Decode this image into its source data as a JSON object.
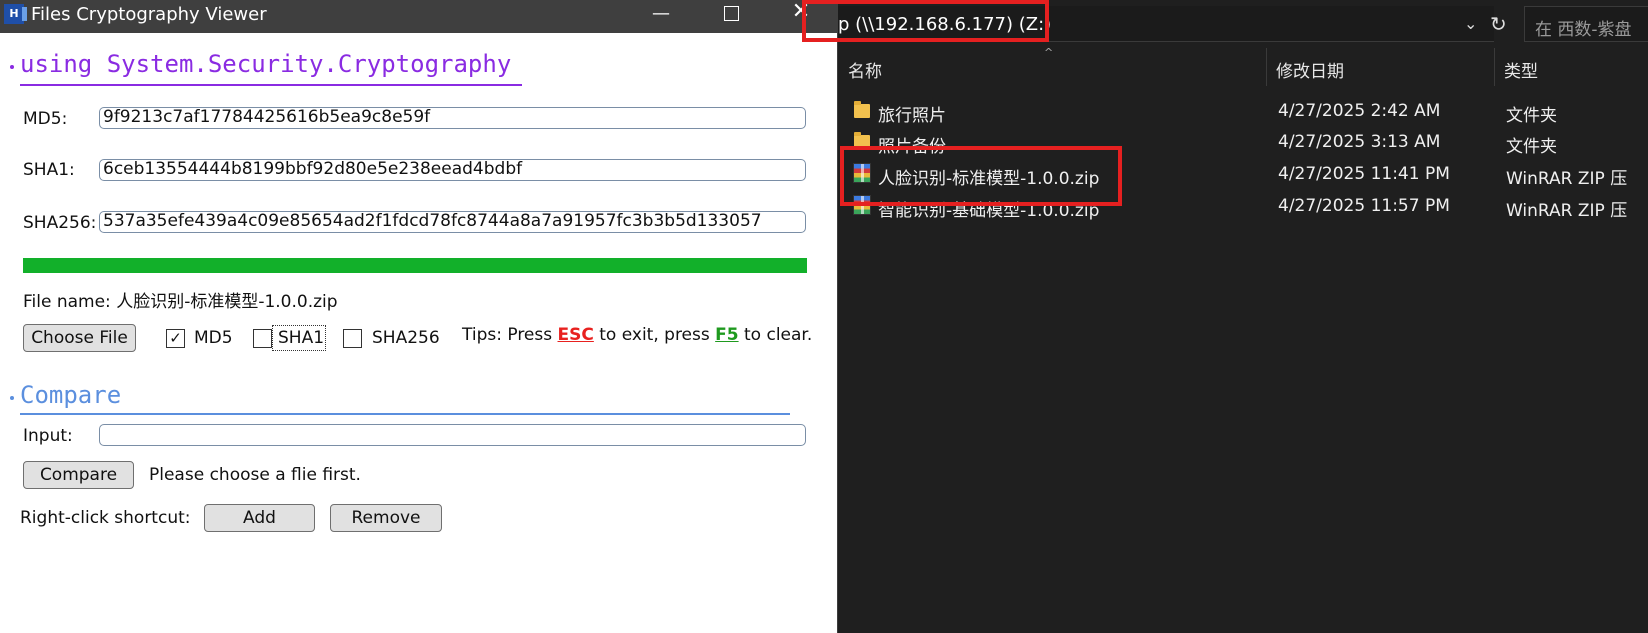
{
  "app": {
    "title": "Files Cryptography Viewer",
    "icon_letter": "H",
    "controls": {
      "minimize": "—",
      "close": "✕"
    },
    "hash_section": {
      "title": "using System.Security.Cryptography",
      "md5_label": "MD5:",
      "md5_value": "9f9213c7af17784425616b5ea9c8e59f",
      "sha1_label": "SHA1:",
      "sha1_value": "6ceb13554444b8199bbf92d80e5e238eead4bdbf",
      "sha256_label": "SHA256:",
      "sha256_value": "537a35efe439a4c09e85654ad2f1fdcd78fc8744a8a7a91957fc3b3b5d133057",
      "progress_fraction": 1.0,
      "file_name_text": "File name: 人脸识别-标准模型-1.0.0.zip",
      "choose_file_label": "Choose File",
      "md5_checkbox": {
        "label": "MD5",
        "checked": true,
        "mark": "✓"
      },
      "sha1_checkbox": {
        "label": "SHA1",
        "checked": false,
        "mark": ""
      },
      "sha256_checkbox": {
        "label": "SHA256",
        "checked": false,
        "mark": ""
      },
      "tips": {
        "prefix": "Tips: Press ",
        "esc": "ESC",
        "middle": " to exit, press ",
        "f5": "F5",
        "suffix": " to clear."
      }
    },
    "compare_section": {
      "title": "Compare",
      "input_label": "Input:",
      "input_value": "",
      "compare_label": "Compare",
      "status_text": "Please choose a flie first.",
      "shortcut_label": "Right-click shortcut:",
      "add_label": "Add",
      "remove_label": "Remove"
    }
  },
  "explorer": {
    "address_text": "p (\\\\192.168.6.177) (Z:)",
    "address_chevron": "⌄",
    "refresh_glyph": "↻",
    "search_placeholder": "在 西数-紫盘",
    "sort_caret": "^",
    "columns": {
      "name": "名称",
      "date": "修改日期",
      "type": "类型"
    },
    "rows": [
      {
        "name": "旅行照片",
        "date": "4/27/2025 2:42 AM",
        "type": "文件夹",
        "icon": "folder-icon"
      },
      {
        "name": "照片备份",
        "date": "4/27/2025 3:13 AM",
        "type": "文件夹",
        "icon": "folder-icon"
      },
      {
        "name": "人脸识别-标准模型-1.0.0.zip",
        "date": "4/27/2025 11:41 PM",
        "type": "WinRAR ZIP 压",
        "icon": "winrar-zip-icon"
      },
      {
        "name": "智能识别-基础模型-1.0.0.zip",
        "date": "4/27/2025 11:57 PM",
        "type": "WinRAR ZIP 压",
        "icon": "winrar-zip-icon"
      }
    ],
    "colors": {
      "background": "#1f1f1f",
      "highlight": "#e52020"
    }
  }
}
